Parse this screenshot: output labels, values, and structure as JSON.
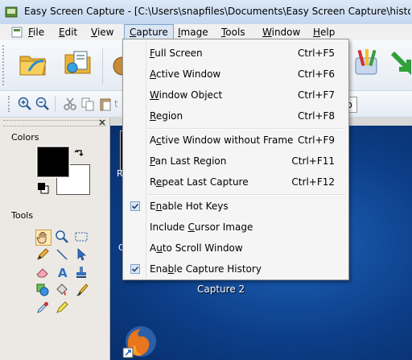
{
  "window": {
    "title": "Easy Screen Capture - [C:\\Users\\snapfiles\\Documents\\Easy Screen Capture\\history\\NewPict"
  },
  "menubar": {
    "items": [
      {
        "label": "File"
      },
      {
        "label": "Edit"
      },
      {
        "label": "View"
      },
      {
        "label": "Capture"
      },
      {
        "label": "Image"
      },
      {
        "label": "Tools"
      },
      {
        "label": "Window"
      },
      {
        "label": "Help"
      }
    ]
  },
  "panel": {
    "colors_label": "Colors",
    "tools_label": "Tools",
    "colors": {
      "primary": "#000000",
      "secondary": "#ffffff"
    }
  },
  "canvas": {
    "tab_label": "p",
    "clipped_label": "R",
    "desktop_icon_label": "Capture 2",
    "desktop_icon_clipped": "C"
  },
  "capture_menu": {
    "items": [
      {
        "label": "Full Screen",
        "shortcut": "Ctrl+F5"
      },
      {
        "label": "Active Window",
        "shortcut": "Ctrl+F6"
      },
      {
        "label": "Window Object",
        "shortcut": "Ctrl+F7"
      },
      {
        "label": "Region",
        "shortcut": "Ctrl+F8"
      },
      {
        "label": "Active Window without Frame",
        "shortcut": "Ctrl+F9"
      },
      {
        "label": "Pan Last Region",
        "shortcut": "Ctrl+F11"
      },
      {
        "label": "Repeat Last Capture",
        "shortcut": "Ctrl+F12"
      },
      {
        "label": "Enable Hot Keys",
        "checked": true
      },
      {
        "label": "Include Cursor Image",
        "checked": false
      },
      {
        "label": "Auto Scroll Window",
        "checked": false
      },
      {
        "label": "Enable Capture History",
        "checked": true
      }
    ]
  }
}
